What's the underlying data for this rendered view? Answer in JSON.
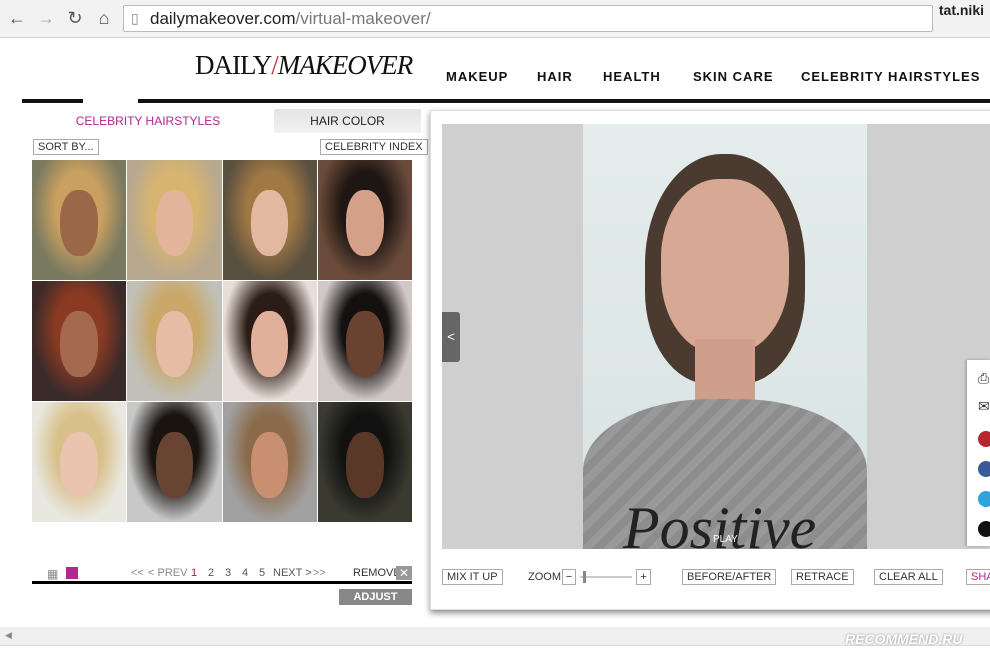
{
  "browser": {
    "url_domain": "dailymakeover.com",
    "url_path": "/virtual-makeover/",
    "user": "tat.niki",
    "icons": [
      "back-icon",
      "forward-icon",
      "reload-icon",
      "home-icon",
      "page-icon"
    ]
  },
  "header": {
    "logo": "DAILY/MAKEOVER",
    "logo_left": "DAILY",
    "logo_slash": "/",
    "logo_right": "MAKEOVER",
    "nav": [
      "MAKEUP",
      "HAIR",
      "HEALTH",
      "SKIN CARE",
      "CELEBRITY HAIRSTYLES"
    ]
  },
  "left": {
    "tabs": [
      {
        "label": "CELEBRITY HAIRSTYLES",
        "active": true
      },
      {
        "label": "HAIR COLOR",
        "active": false
      }
    ],
    "sort_by": "SORT BY...",
    "celebrity_index": "CELEBRITY INDEX",
    "pagination": {
      "first": "<<",
      "prev": "< PREV",
      "pages": [
        "1",
        "2",
        "3",
        "4",
        "5"
      ],
      "current": "1",
      "next": "NEXT >",
      "last": ">>"
    },
    "remove": "REMOVE",
    "adjust_hair": "ADJUST HAIR",
    "accent": "#b0288f"
  },
  "right": {
    "play": "PLAY",
    "prev_arrow": "<",
    "controls": {
      "mix": "MIX IT UP",
      "zoom": "ZOOM",
      "zoom_minus": "−",
      "zoom_plus": "+",
      "zoom_level": 0.05,
      "before_after": "BEFORE/AFTER",
      "retrace": "RETRACE",
      "clear_all": "CLEAR ALL",
      "share": "SHA"
    },
    "social": [
      "print-icon",
      "email-icon",
      "pinterest-icon",
      "facebook-icon",
      "twitter-icon",
      "share-icon"
    ]
  },
  "watermark": "RECOMMEND.RU"
}
